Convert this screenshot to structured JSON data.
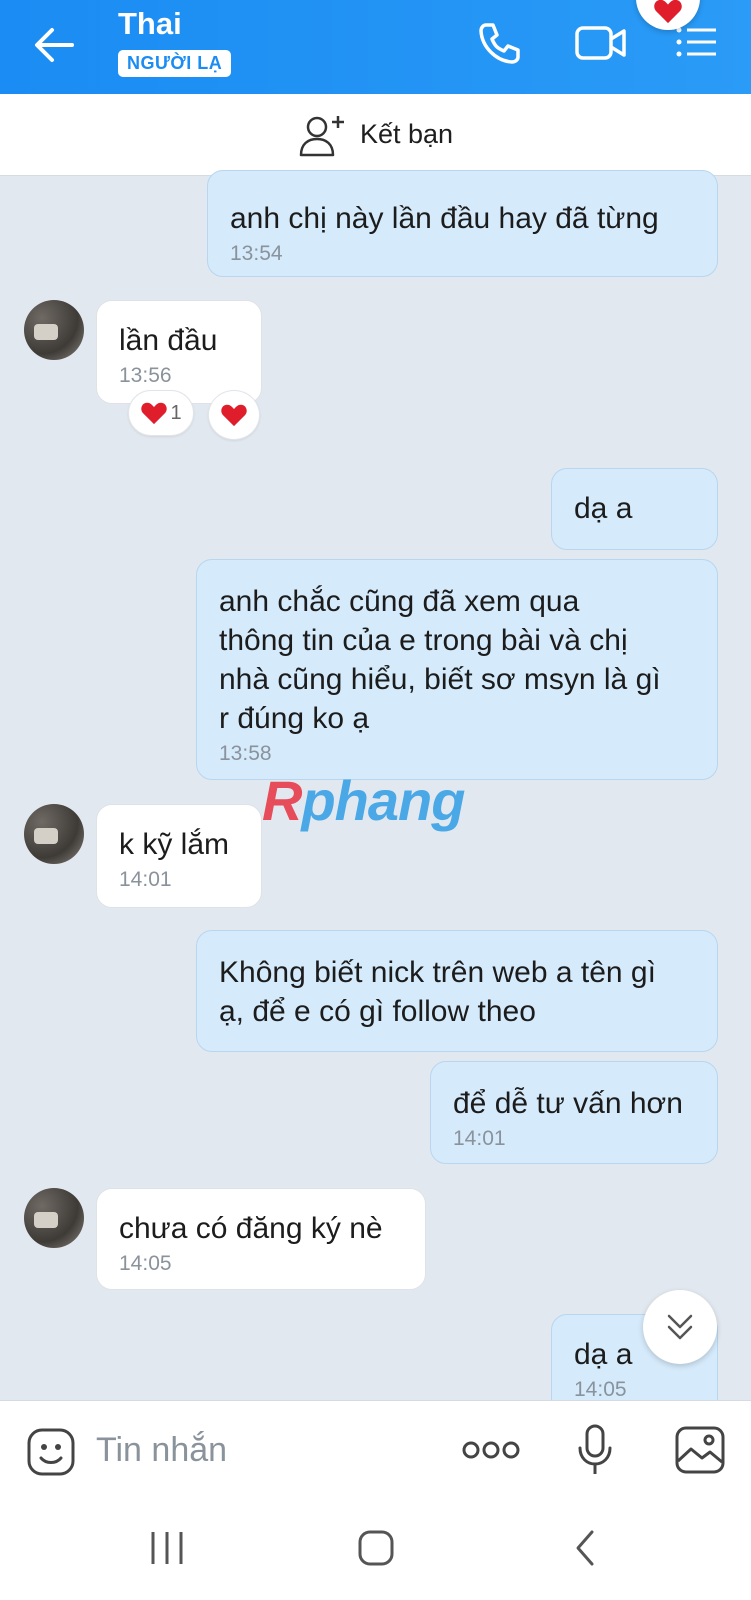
{
  "header": {
    "title": "Thai",
    "badge": "NGƯỜI LẠ",
    "back_icon": "arrow-left-icon",
    "call_icon": "phone-icon",
    "video_icon": "video-camera-icon",
    "menu_icon": "list-menu-icon"
  },
  "friend_bar": {
    "label": "Kết bạn",
    "icon": "add-user-icon"
  },
  "messages": [
    {
      "from": "me",
      "text": "anh chị này lần đầu hay đã từng",
      "time": "13:54"
    },
    {
      "from": "them",
      "text": "lần đầu",
      "time": "13:56",
      "reactions": [
        {
          "emoji": "heart",
          "count": "1"
        },
        {
          "emoji": "heart",
          "count": ""
        }
      ]
    },
    {
      "from": "me",
      "text": "dạ a",
      "time": ""
    },
    {
      "from": "me",
      "text": "anh chắc cũng đã xem qua\nthông tin của e trong bài và chị\nnhà cũng hiểu, biết sơ msyn là gì\nr đúng ko ạ",
      "time": "13:58"
    },
    {
      "from": "them",
      "text": "k kỹ lắm",
      "time": "14:01"
    },
    {
      "from": "me",
      "text": "Không biết nick trên web a tên gì\nạ, để e có gì follow theo",
      "time": ""
    },
    {
      "from": "me",
      "text": "để dễ tư vấn hơn",
      "time": "14:01"
    },
    {
      "from": "them",
      "text": "chưa có đăng ký nè",
      "time": "14:05"
    },
    {
      "from": "me",
      "text": "dạ a",
      "time": "14:05"
    }
  ],
  "watermark": {
    "part1": "R",
    "part2": "phang"
  },
  "composer": {
    "placeholder": "Tin nhắn",
    "emoji_icon": "sticker-face-icon",
    "more_icon": "more-dots-icon",
    "mic_icon": "microphone-icon",
    "image_icon": "image-icon"
  },
  "colors": {
    "header": "#1a8cf3",
    "my_bubble": "#d5eafb",
    "their_bubble": "#ffffff",
    "background": "#e2e8ef",
    "heart": "#e01e2b"
  }
}
